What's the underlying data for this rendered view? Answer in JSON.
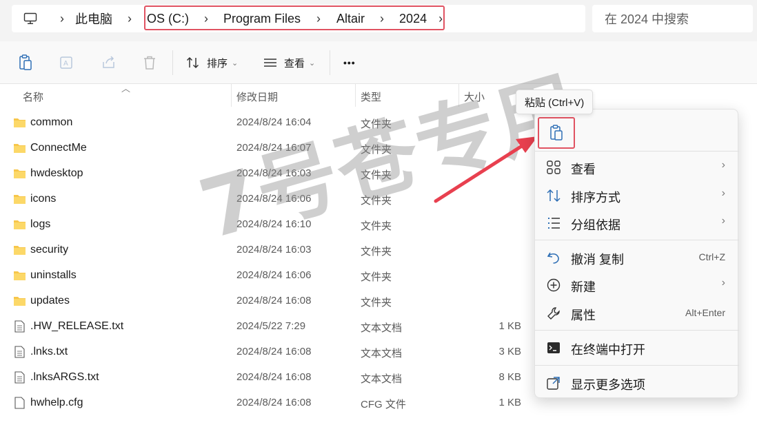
{
  "address_bar": {
    "crumbs": [
      "此电脑",
      "OS (C:)",
      "Program Files",
      "Altair",
      "2024"
    ],
    "search_placeholder": "在 2024 中搜索"
  },
  "toolbar": {
    "sort_label": "排序",
    "view_label": "查看",
    "more_label": "•••"
  },
  "columns": {
    "name": "名称",
    "modified": "修改日期",
    "type": "类型",
    "size": "大小"
  },
  "files": [
    {
      "name": "common",
      "date": "2024/8/24 16:04",
      "type": "文件夹",
      "size": "",
      "kind": "folder"
    },
    {
      "name": "ConnectMe",
      "date": "2024/8/24 16:07",
      "type": "文件夹",
      "size": "",
      "kind": "folder"
    },
    {
      "name": "hwdesktop",
      "date": "2024/8/24 16:03",
      "type": "文件夹",
      "size": "",
      "kind": "folder"
    },
    {
      "name": "icons",
      "date": "2024/8/24 16:06",
      "type": "文件夹",
      "size": "",
      "kind": "folder"
    },
    {
      "name": "logs",
      "date": "2024/8/24 16:10",
      "type": "文件夹",
      "size": "",
      "kind": "folder"
    },
    {
      "name": "security",
      "date": "2024/8/24 16:03",
      "type": "文件夹",
      "size": "",
      "kind": "folder"
    },
    {
      "name": "uninstalls",
      "date": "2024/8/24 16:06",
      "type": "文件夹",
      "size": "",
      "kind": "folder"
    },
    {
      "name": "updates",
      "date": "2024/8/24 16:08",
      "type": "文件夹",
      "size": "",
      "kind": "folder"
    },
    {
      "name": ".HW_RELEASE.txt",
      "date": "2024/5/22 7:29",
      "type": "文本文档",
      "size": "1 KB",
      "kind": "text"
    },
    {
      "name": ".lnks.txt",
      "date": "2024/8/24 16:08",
      "type": "文本文档",
      "size": "3 KB",
      "kind": "text"
    },
    {
      "name": ".lnksARGS.txt",
      "date": "2024/8/24 16:08",
      "type": "文本文档",
      "size": "8 KB",
      "kind": "text"
    },
    {
      "name": "hwhelp.cfg",
      "date": "2024/8/24 16:08",
      "type": "CFG 文件",
      "size": "1 KB",
      "kind": "file"
    }
  ],
  "watermark": "7号苍专用",
  "tooltip": "粘贴 (Ctrl+V)",
  "context_menu": {
    "items": [
      {
        "label": "查看",
        "shortcut": "",
        "submenu": true
      },
      {
        "label": "排序方式",
        "shortcut": "",
        "submenu": true
      },
      {
        "label": "分组依据",
        "shortcut": "",
        "submenu": true
      },
      {
        "label": "撤消 复制",
        "shortcut": "Ctrl+Z",
        "submenu": false
      },
      {
        "label": "新建",
        "shortcut": "",
        "submenu": true
      },
      {
        "label": "属性",
        "shortcut": "Alt+Enter",
        "submenu": false
      },
      {
        "label": "在终端中打开",
        "shortcut": "",
        "submenu": false
      },
      {
        "label": "显示更多选项",
        "shortcut": "",
        "submenu": false
      }
    ]
  },
  "colors": {
    "highlight": "#e05261",
    "folder": "#f7c64a",
    "accent": "#2f6fb5"
  }
}
